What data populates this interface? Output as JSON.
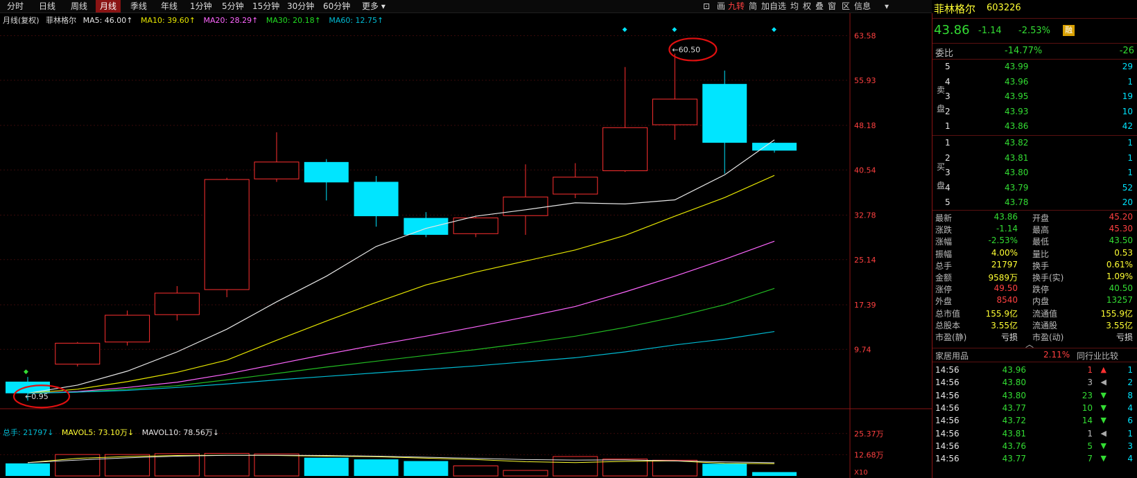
{
  "toolbar": {
    "period_tabs": [
      {
        "label": "分时",
        "active": false
      },
      {
        "label": "日线",
        "active": false
      },
      {
        "label": "周线",
        "active": false
      },
      {
        "label": "月线",
        "active": true
      },
      {
        "label": "季线",
        "active": false
      },
      {
        "label": "年线",
        "active": false
      },
      {
        "label": "1分钟",
        "active": false
      },
      {
        "label": "5分钟",
        "active": false
      },
      {
        "label": "15分钟",
        "active": false
      },
      {
        "label": "30分钟",
        "active": false
      },
      {
        "label": "60分钟",
        "active": false
      },
      {
        "label": "更多 ▾",
        "active": false
      }
    ],
    "tools": [
      "⊡",
      "画",
      "九转",
      "简",
      "加自选",
      "均",
      "权",
      "叠",
      "窗",
      "区",
      "信息",
      "▾"
    ]
  },
  "chart_header": {
    "period_label": "月线(复权)",
    "stock_name": "菲林格尔",
    "ma5_label": "MA5: 46.00↑",
    "ma10_label": "MA10: 39.60↑",
    "ma20_label": "MA20: 28.29↑",
    "ma30_label": "MA30: 20.18↑",
    "ma60_label": "MA60: 12.75↑"
  },
  "volume_header": {
    "total_label": "总手: 21797↓",
    "mavol5_label": "MAVOL5: 73.10万↓",
    "mavol10_label": "MAVOL10: 78.56万↓"
  },
  "colors": {
    "up": "#ff3030",
    "down": "#00e5ff",
    "ma5": "#e6e6e6",
    "ma10": "#e6e600",
    "ma20": "#ff66ff",
    "ma30": "#22bb22",
    "ma60": "#00bcd4",
    "grid": "#3a0a0a"
  },
  "chart_data": {
    "type": "candlestick",
    "price_axis": {
      "ticks": [
        63.58,
        55.93,
        48.18,
        40.54,
        32.78,
        25.14,
        17.39,
        9.74
      ],
      "ylim": [
        0.5,
        66.5
      ]
    },
    "candles": [
      {
        "open": 4.2,
        "close": 2.2,
        "high": 5.0,
        "low": 0.95
      },
      {
        "open": 7.2,
        "close": 10.8,
        "high": 11.0,
        "low": 6.8
      },
      {
        "open": 11.0,
        "close": 15.6,
        "high": 16.4,
        "low": 10.4
      },
      {
        "open": 15.7,
        "close": 19.4,
        "high": 20.6,
        "low": 14.7
      },
      {
        "open": 20.0,
        "close": 38.9,
        "high": 39.2,
        "low": 18.7
      },
      {
        "open": 39.0,
        "close": 41.9,
        "high": 47.0,
        "low": 38.5
      },
      {
        "open": 41.9,
        "close": 38.4,
        "high": 42.4,
        "low": 35.3
      },
      {
        "open": 38.5,
        "close": 32.6,
        "high": 39.5,
        "low": 30.8
      },
      {
        "open": 32.3,
        "close": 29.4,
        "high": 33.3,
        "low": 29.0
      },
      {
        "open": 29.6,
        "close": 32.3,
        "high": 32.5,
        "low": 29.0
      },
      {
        "open": 32.7,
        "close": 35.9,
        "high": 41.5,
        "low": 29.4
      },
      {
        "open": 36.4,
        "close": 39.3,
        "high": 41.7,
        "low": 35.7
      },
      {
        "open": 40.4,
        "close": 47.8,
        "high": 58.2,
        "low": 40.2
      },
      {
        "open": 48.3,
        "close": 52.7,
        "high": 60.5,
        "low": 45.7
      },
      {
        "open": 55.3,
        "close": 45.2,
        "high": 57.6,
        "low": 39.9
      },
      {
        "open": 45.2,
        "close": 43.86,
        "high": 45.3,
        "low": 43.5
      }
    ],
    "ma5": [
      2.2,
      3.6,
      6.0,
      9.3,
      13.2,
      17.9,
      22.3,
      27.4,
      30.5,
      32.6,
      33.7,
      34.9,
      34.7,
      35.4,
      39.7,
      45.7
    ],
    "ma10": [
      2.2,
      2.9,
      4.2,
      5.8,
      7.9,
      11.3,
      14.6,
      17.8,
      20.8,
      23.0,
      24.9,
      26.8,
      29.3,
      32.6,
      35.8,
      39.6
    ],
    "ma20": [
      2.2,
      2.5,
      3.2,
      4.1,
      5.5,
      7.2,
      8.9,
      10.5,
      12.0,
      13.6,
      15.3,
      17.1,
      19.6,
      22.3,
      25.2,
      28.3
    ],
    "ma30": [
      2.2,
      2.4,
      2.9,
      3.5,
      4.5,
      5.6,
      6.7,
      7.7,
      8.7,
      9.7,
      10.8,
      12.0,
      13.5,
      15.3,
      17.4,
      20.2
    ],
    "ma60": [
      2.2,
      2.4,
      2.7,
      3.2,
      3.8,
      4.5,
      5.1,
      5.7,
      6.3,
      6.9,
      7.6,
      8.3,
      9.3,
      10.5,
      11.5,
      12.8
    ],
    "volume_axis": {
      "ticks": [
        "25.37万",
        "12.68万"
      ],
      "tick_values": [
        25.37,
        12.68
      ],
      "unit_label": "X10",
      "ylim": [
        0,
        29
      ]
    },
    "volumes": [
      7.5,
      12.8,
      12.8,
      13.3,
      13.5,
      13.2,
      10.9,
      9.9,
      8.9,
      6.0,
      3.3,
      11.6,
      10.1,
      9.4,
      7.3,
      2.3
    ],
    "mavol5": [
      8.0,
      10.5,
      11.6,
      12.2,
      12.4,
      12.2,
      11.8,
      11.5,
      10.6,
      9.8,
      8.5,
      8.0,
      8.7,
      9.0,
      7.5,
      7.3
    ],
    "mavol10": [
      8.0,
      9.5,
      10.8,
      11.8,
      12.3,
      12.4,
      12.2,
      11.8,
      11.2,
      10.5,
      9.8,
      9.5,
      9.6,
      9.0,
      8.4,
      7.9
    ],
    "annotations": [
      {
        "label": "←60.50",
        "candle": 13
      },
      {
        "label": "←0.95",
        "candle": 0
      }
    ],
    "markers": [
      "◆",
      "◆",
      "◆",
      "◆"
    ]
  },
  "quote_panel": {
    "stock_name": "菲林格尔",
    "stock_code": "603226",
    "price": "43.86",
    "change": "-1.14",
    "change_pct": "-2.53%",
    "badge": "融",
    "weibi_label": "委比",
    "weibi_pct": "-14.77%",
    "weibi_diff": "-26",
    "sell_label": [
      "卖",
      "盘"
    ],
    "buy_label": [
      "买",
      "盘"
    ],
    "sell_levels": [
      {
        "lvl": "5",
        "price": "43.99",
        "vol": "29"
      },
      {
        "lvl": "4",
        "price": "43.96",
        "vol": "1"
      },
      {
        "lvl": "3",
        "price": "43.95",
        "vol": "19"
      },
      {
        "lvl": "2",
        "price": "43.93",
        "vol": "10"
      },
      {
        "lvl": "1",
        "price": "43.86",
        "vol": "42"
      }
    ],
    "buy_levels": [
      {
        "lvl": "1",
        "price": "43.82",
        "vol": "1"
      },
      {
        "lvl": "2",
        "price": "43.81",
        "vol": "1"
      },
      {
        "lvl": "3",
        "price": "43.80",
        "vol": "1"
      },
      {
        "lvl": "4",
        "price": "43.79",
        "vol": "52"
      },
      {
        "lvl": "5",
        "price": "43.78",
        "vol": "20"
      }
    ],
    "stats": [
      {
        "l1": "最新",
        "v1": "43.86",
        "c1": "green",
        "l2": "开盘",
        "v2": "45.20",
        "c2": "red"
      },
      {
        "l1": "涨跌",
        "v1": "-1.14",
        "c1": "green",
        "l2": "最高",
        "v2": "45.30",
        "c2": "red"
      },
      {
        "l1": "涨幅",
        "v1": "-2.53%",
        "c1": "green",
        "l2": "最低",
        "v2": "43.50",
        "c2": "green"
      },
      {
        "l1": "振幅",
        "v1": "4.00%",
        "c1": "yellow",
        "l2": "量比",
        "v2": "0.53",
        "c2": "yellow"
      },
      {
        "l1": "总手",
        "v1": "21797",
        "c1": "yellow",
        "l2": "换手",
        "v2": "0.61%",
        "c2": "yellow"
      },
      {
        "l1": "金额",
        "v1": "9589万",
        "c1": "yellow",
        "l2": "换手(实)",
        "v2": "1.09%",
        "c2": "yellow"
      },
      {
        "l1": "涨停",
        "v1": "49.50",
        "c1": "red",
        "l2": "跌停",
        "v2": "40.50",
        "c2": "green"
      },
      {
        "l1": "外盘",
        "v1": "8540",
        "c1": "red",
        "l2": "内盘",
        "v2": "13257",
        "c2": "green"
      },
      {
        "l1": "总市值",
        "v1": "155.9亿",
        "c1": "yellow",
        "l2": "流通值",
        "v2": "155.9亿",
        "c2": "yellow"
      },
      {
        "l1": "总股本",
        "v1": "3.55亿",
        "c1": "yellow",
        "l2": "流通股",
        "v2": "3.55亿",
        "c2": "yellow"
      },
      {
        "l1": "市盈(静)",
        "v1": "亏损",
        "c1": "white",
        "l2": "市盈(动)",
        "v2": "亏损",
        "c2": "white"
      }
    ],
    "collapse_glyph": "︿",
    "industry": {
      "name": "家居用品",
      "pct": "2.11%",
      "compare": "同行业比较"
    },
    "trades": [
      {
        "time": "14:56",
        "price": "43.96",
        "vol": "1",
        "dir": "up",
        "n": "1"
      },
      {
        "time": "14:56",
        "price": "43.80",
        "vol": "3",
        "dir": "flat",
        "n": "2"
      },
      {
        "time": "14:56",
        "price": "43.80",
        "vol": "23",
        "dir": "down",
        "n": "8"
      },
      {
        "time": "14:56",
        "price": "43.77",
        "vol": "10",
        "dir": "down",
        "n": "4"
      },
      {
        "time": "14:56",
        "price": "43.72",
        "vol": "14",
        "dir": "down",
        "n": "6"
      },
      {
        "time": "14:56",
        "price": "43.81",
        "vol": "1",
        "dir": "flat",
        "n": "1"
      },
      {
        "time": "14:56",
        "price": "43.76",
        "vol": "5",
        "dir": "down",
        "n": "3"
      },
      {
        "time": "14:56",
        "price": "43.77",
        "vol": "7",
        "dir": "down",
        "n": "4"
      }
    ]
  }
}
